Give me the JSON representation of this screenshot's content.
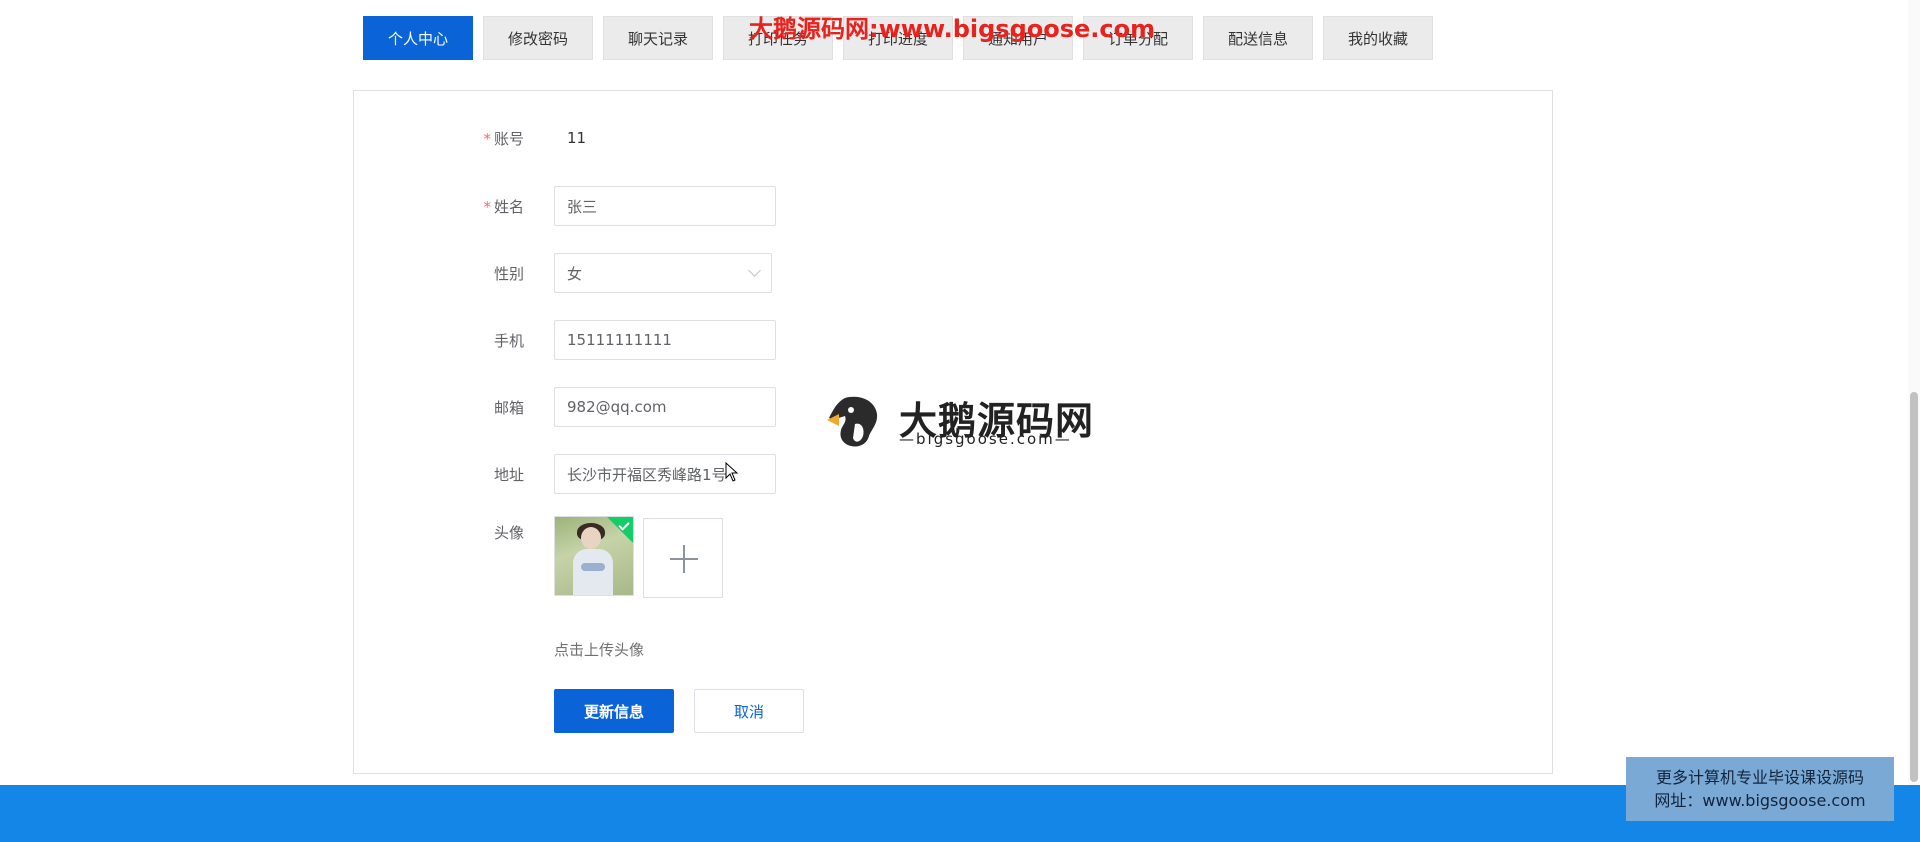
{
  "watermark_top": "大鹅源码网:www.bigsgoose.com",
  "tabs": [
    {
      "label": "个人中心",
      "active": true
    },
    {
      "label": "修改密码",
      "active": false
    },
    {
      "label": "聊天记录",
      "active": false
    },
    {
      "label": "打印任务",
      "active": false
    },
    {
      "label": "打印进度",
      "active": false
    },
    {
      "label": "通知用户",
      "active": false
    },
    {
      "label": "订单分配",
      "active": false
    },
    {
      "label": "配送信息",
      "active": false
    },
    {
      "label": "我的收藏",
      "active": false
    }
  ],
  "form": {
    "required_mark": "*",
    "account": {
      "label": "账号",
      "value": "11"
    },
    "name": {
      "label": "姓名",
      "value": "张三"
    },
    "gender": {
      "label": "性别",
      "value": "女"
    },
    "phone": {
      "label": "手机",
      "value": "15111111111"
    },
    "email": {
      "label": "邮箱",
      "value": "982@qq.com"
    },
    "address": {
      "label": "地址",
      "value": "长沙市开福区秀峰路1号"
    },
    "avatar": {
      "label": "头像",
      "tip": "点击上传头像"
    }
  },
  "actions": {
    "update_label": "更新信息",
    "cancel_label": "取消"
  },
  "watermark_center": {
    "title": "大鹅源码网",
    "subtitle": "—bigsgoose.com—"
  },
  "promo": {
    "line1": "更多计算机专业毕设课设源码",
    "line2": "网址：www.bigsgoose.com"
  },
  "colors": {
    "primary": "#0b63d8",
    "footer": "#1486e8",
    "required": "#f56c6c",
    "watermark": "#e8221c"
  }
}
